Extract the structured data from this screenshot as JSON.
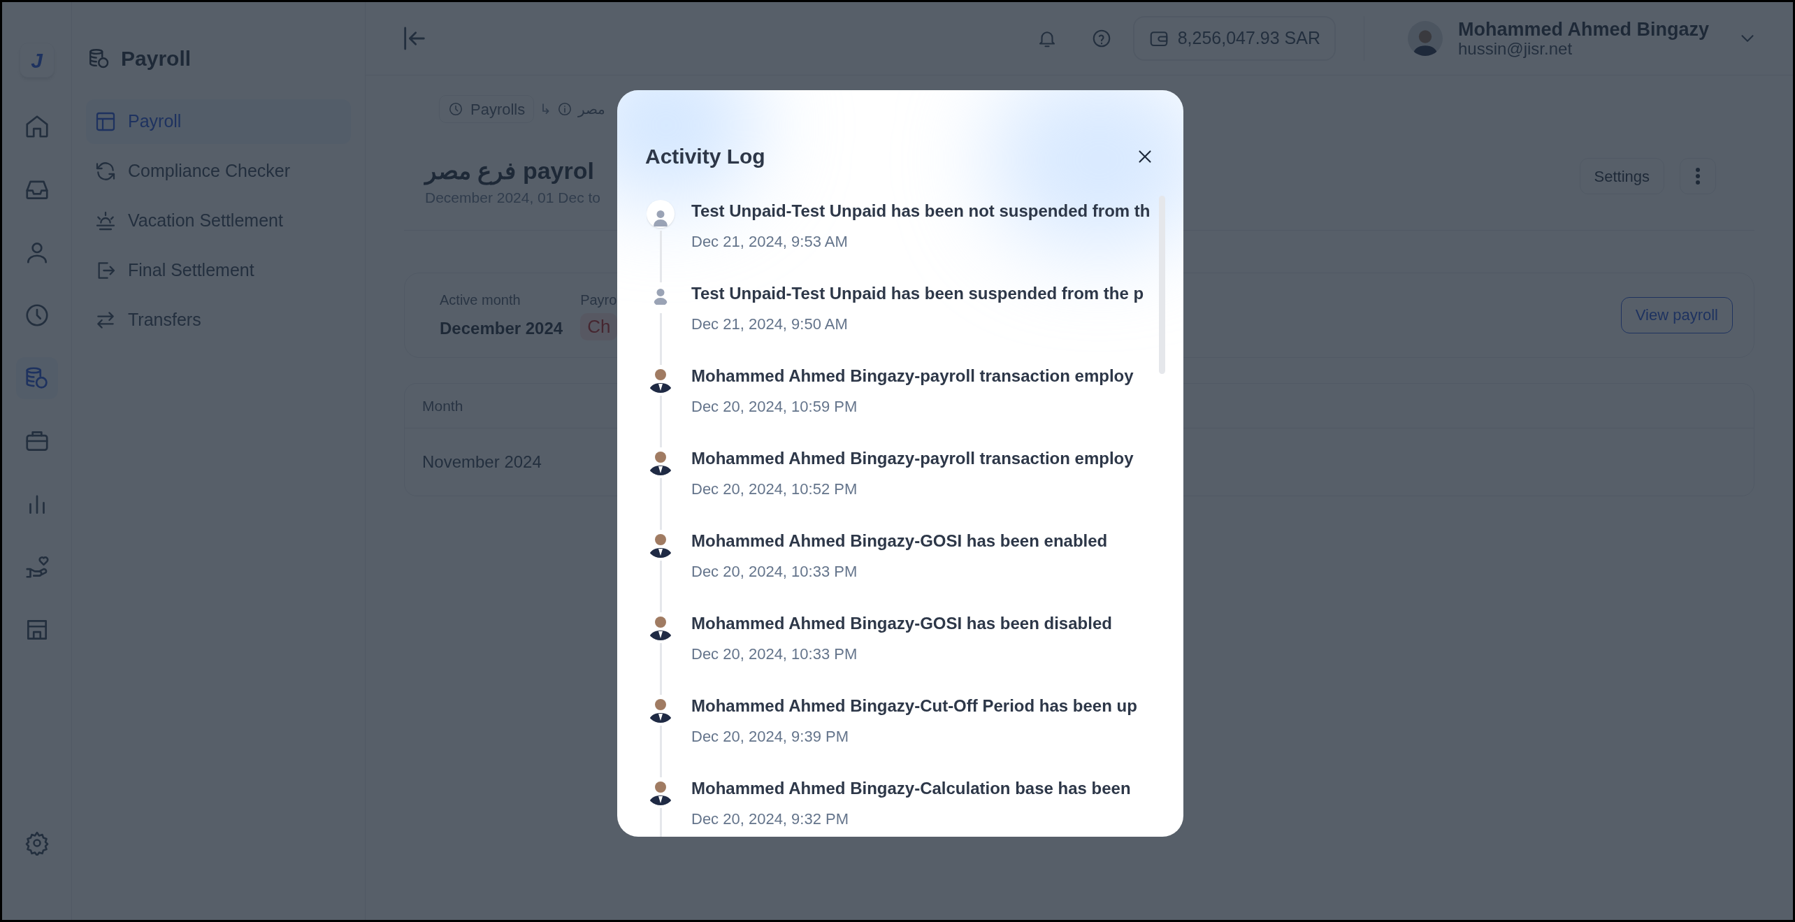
{
  "rail": {
    "logo": "J",
    "items": [
      {
        "kind": "home",
        "selected": false
      },
      {
        "kind": "inbox",
        "selected": false
      },
      {
        "kind": "user",
        "selected": false
      },
      {
        "kind": "clock",
        "selected": false
      },
      {
        "kind": "payroll",
        "selected": true
      },
      {
        "kind": "briefcase",
        "selected": false
      },
      {
        "kind": "chart",
        "selected": false
      },
      {
        "kind": "hand",
        "selected": false
      },
      {
        "kind": "store",
        "selected": false
      }
    ]
  },
  "sidebar": {
    "title": "Payroll",
    "items": [
      {
        "kind": "table",
        "label": "Payroll",
        "selected": true
      },
      {
        "kind": "refresh",
        "label": "Compliance Checker",
        "selected": false
      },
      {
        "kind": "sunset",
        "label": "Vacation Settlement",
        "selected": false
      },
      {
        "kind": "exit",
        "label": "Final Settlement",
        "selected": false
      },
      {
        "kind": "transfer",
        "label": "Transfers",
        "selected": false
      }
    ]
  },
  "topbar": {
    "balance": "8,256,047.93 SAR",
    "user_name": "Mohammed Ahmed Bingazy",
    "user_email": "hussin@jisr.net"
  },
  "breadcrumb": {
    "first": "Payrolls",
    "separator": "↳",
    "second": "مصر"
  },
  "page": {
    "title": "فرع مصر payrol",
    "subtitle": "December 2024, 01 Dec to",
    "settings_button": "Settings"
  },
  "summary_card": {
    "label_1": "Active month",
    "value_1": "December 2024",
    "label_2": "Payro",
    "status": "Ch",
    "button": "View payroll"
  },
  "table": {
    "columns": [
      "Month"
    ],
    "rows": [
      [
        "November 2024"
      ]
    ]
  },
  "dialog": {
    "title": "Activity Log",
    "entries": [
      {
        "kind": "generic",
        "highlighted": true,
        "text": "Test Unpaid-Test Unpaid has been not suspended from th",
        "time": "Dec 21, 2024, 9:53 AM"
      },
      {
        "kind": "generic",
        "highlighted": false,
        "text": "Test Unpaid-Test Unpaid has been suspended from the p",
        "time": "Dec 21, 2024, 9:50 AM"
      },
      {
        "kind": "photo",
        "highlighted": false,
        "text": "Mohammed Ahmed Bingazy-payroll transaction employ",
        "time": "Dec 20, 2024, 10:59 PM"
      },
      {
        "kind": "photo",
        "highlighted": false,
        "text": "Mohammed Ahmed Bingazy-payroll transaction employ",
        "time": "Dec 20, 2024, 10:52 PM"
      },
      {
        "kind": "photo",
        "highlighted": false,
        "text": "Mohammed Ahmed Bingazy-GOSI has been enabled",
        "time": "Dec 20, 2024, 10:33 PM"
      },
      {
        "kind": "photo",
        "highlighted": false,
        "text": "Mohammed Ahmed Bingazy-GOSI has been disabled",
        "time": "Dec 20, 2024, 10:33 PM"
      },
      {
        "kind": "photo",
        "highlighted": false,
        "text": "Mohammed Ahmed Bingazy-Cut-Off Period has been up",
        "time": "Dec 20, 2024, 9:39 PM"
      },
      {
        "kind": "photo",
        "highlighted": false,
        "text": "Mohammed Ahmed Bingazy-Calculation base has been",
        "time": "Dec 20, 2024, 9:32 PM"
      }
    ]
  }
}
